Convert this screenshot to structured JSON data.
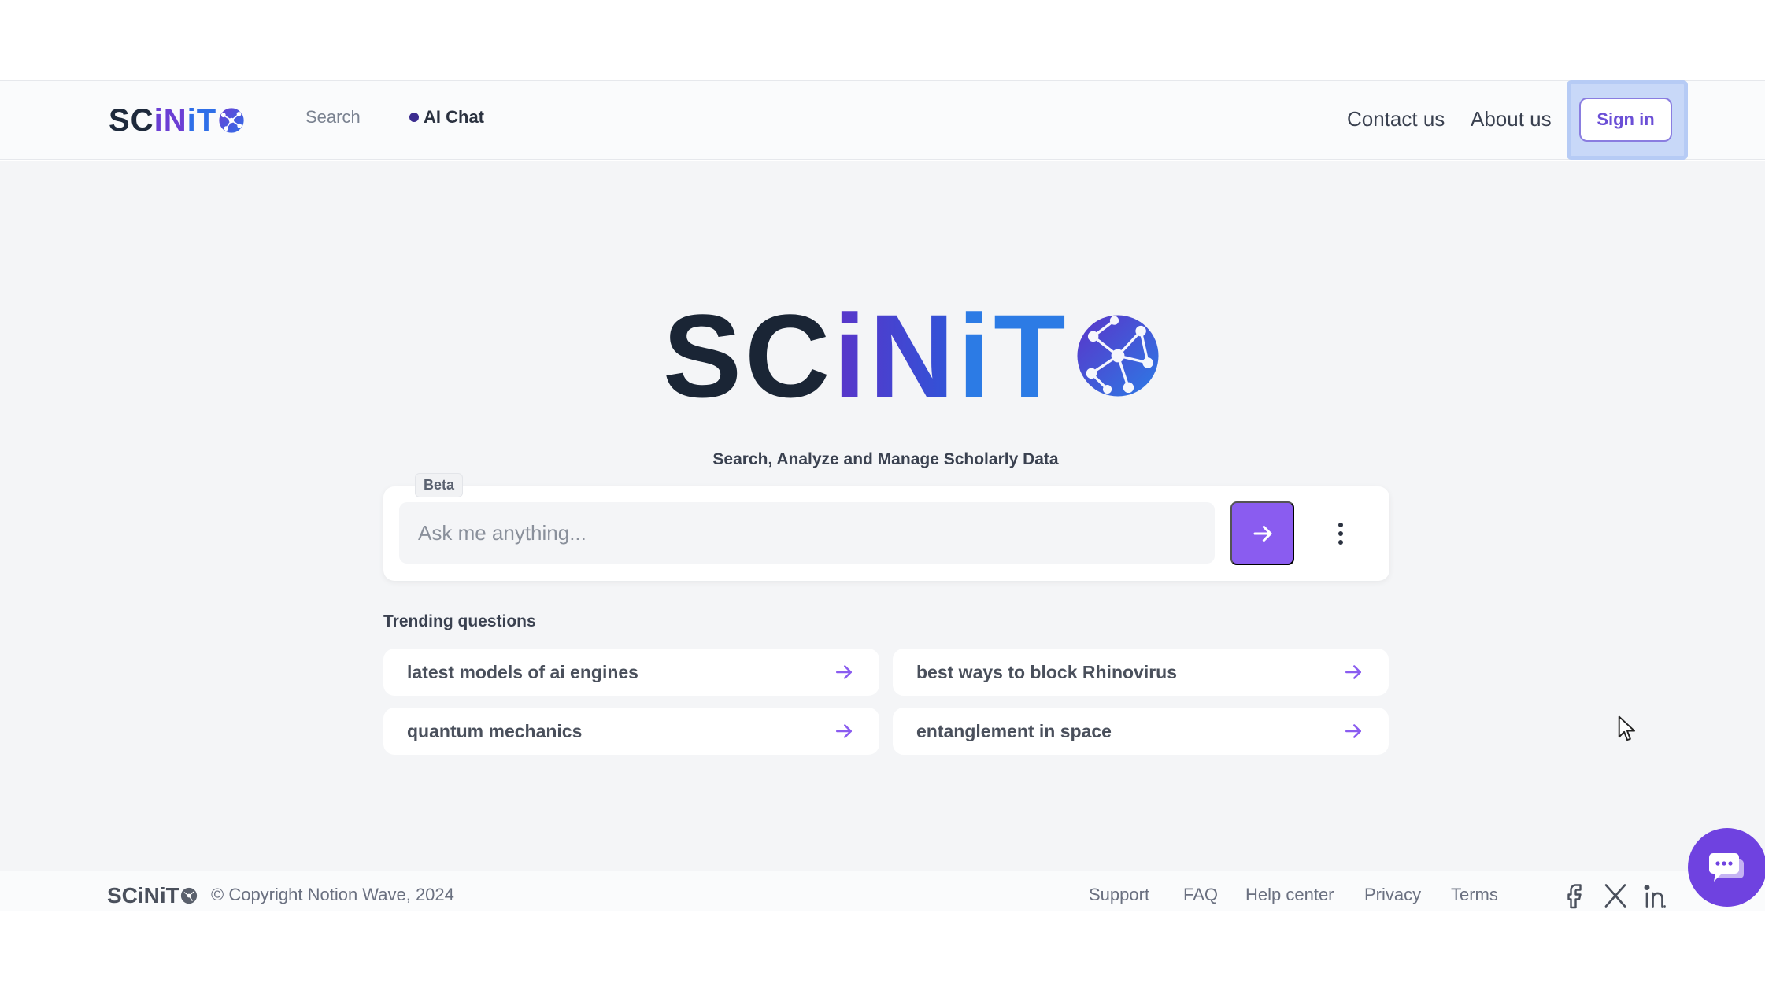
{
  "header": {
    "logo_text_a": "SC",
    "logo_text_b": "iN",
    "logo_text_c": "iT",
    "nav_search": "Search",
    "nav_ai_chat": "AI Chat",
    "contact": "Contact us",
    "about": "About us",
    "sign_in": "Sign in"
  },
  "hero": {
    "logo_a": "SC",
    "logo_b": "iN",
    "logo_c": "iT",
    "tagline": "Search, Analyze and Manage Scholarly Data"
  },
  "search": {
    "badge": "Beta",
    "placeholder": "Ask me anything...",
    "send_icon": "arrow-right-icon",
    "more_icon": "kebab-menu-icon"
  },
  "trending": {
    "title": "Trending questions",
    "items": [
      {
        "label": "latest models of ai engines"
      },
      {
        "label": "best ways to block Rhinovirus"
      },
      {
        "label": "quantum mechanics"
      },
      {
        "label": "entanglement in space"
      }
    ]
  },
  "footer": {
    "logo_text": "SCiNiT",
    "copyright": "© Copyright Notion Wave, 2024",
    "links": [
      "Support",
      "FAQ",
      "Help center",
      "Privacy",
      "Terms"
    ],
    "social": [
      "facebook-icon",
      "x-icon",
      "linkedin-icon"
    ]
  },
  "colors": {
    "accent": "#8a5cf0",
    "brand_dark": "#1a2535",
    "brand_purple": "#5a34c9",
    "brand_blue": "#2c7be5"
  }
}
